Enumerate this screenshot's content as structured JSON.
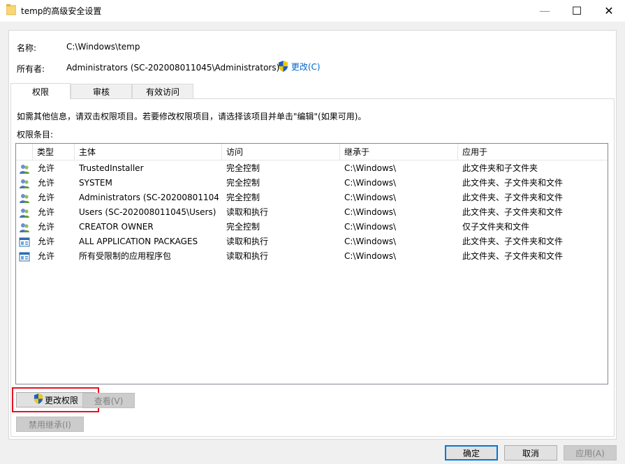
{
  "window": {
    "title": "temp的高级安全设置",
    "minimize_glyph": "—",
    "maximize_glyph": "☐",
    "close_glyph": "✕"
  },
  "name_row": {
    "label": "名称:",
    "value": "C:\\Windows\\temp"
  },
  "owner_row": {
    "label": "所有者:",
    "value": "Administrators (SC-202008011045\\Administrators)",
    "change_link": "更改(C)"
  },
  "tabs": [
    {
      "label": "权限",
      "active": true
    },
    {
      "label": "审核",
      "active": false
    },
    {
      "label": "有效访问",
      "active": false
    }
  ],
  "info_text": "如需其他信息，请双击权限项目。若要修改权限项目，请选择该项目并单击\"编辑\"(如果可用)。",
  "entries_label": "权限条目:",
  "columns": [
    "类型",
    "主体",
    "访问",
    "继承于",
    "应用于"
  ],
  "rows": [
    {
      "icon": "user-group-icon",
      "type": "允许",
      "principal": "TrustedInstaller",
      "access": "完全控制",
      "inherited": "C:\\Windows\\",
      "applies": "此文件夹和子文件夹"
    },
    {
      "icon": "user-group-icon",
      "type": "允许",
      "principal": "SYSTEM",
      "access": "完全控制",
      "inherited": "C:\\Windows\\",
      "applies": "此文件夹、子文件夹和文件"
    },
    {
      "icon": "user-group-icon",
      "type": "允许",
      "principal": "Administrators (SC-20200801104...",
      "access": "完全控制",
      "inherited": "C:\\Windows\\",
      "applies": "此文件夹、子文件夹和文件"
    },
    {
      "icon": "user-group-icon",
      "type": "允许",
      "principal": "Users (SC-202008011045\\Users)",
      "access": "读取和执行",
      "inherited": "C:\\Windows\\",
      "applies": "此文件夹、子文件夹和文件"
    },
    {
      "icon": "user-group-icon",
      "type": "允许",
      "principal": "CREATOR OWNER",
      "access": "完全控制",
      "inherited": "C:\\Windows\\",
      "applies": "仅子文件夹和文件"
    },
    {
      "icon": "app-package-icon",
      "type": "允许",
      "principal": "ALL APPLICATION PACKAGES",
      "access": "读取和执行",
      "inherited": "C:\\Windows\\",
      "applies": "此文件夹、子文件夹和文件"
    },
    {
      "icon": "app-package-icon",
      "type": "允许",
      "principal": "所有受限制的应用程序包",
      "access": "读取和执行",
      "inherited": "C:\\Windows\\",
      "applies": "此文件夹、子文件夹和文件"
    }
  ],
  "buttons": {
    "change_permissions": "更改权限",
    "view": "查看(V)",
    "disable_inheritance": "禁用继承(I)",
    "ok": "确定",
    "cancel": "取消",
    "apply": "应用(A)"
  },
  "colors": {
    "link": "#0066cc",
    "highlight": "#e81123",
    "default_button_border": "#0078d7"
  }
}
